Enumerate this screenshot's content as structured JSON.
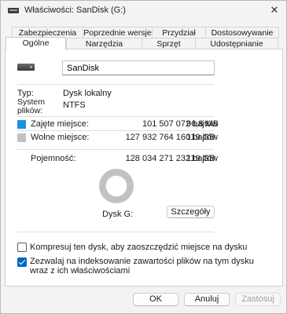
{
  "window": {
    "title": "Właściwości: SanDisk (G:)",
    "close_glyph": "✕"
  },
  "tabs_row1": [
    "Zabezpieczenia",
    "Poprzednie wersje",
    "Przydział",
    "Dostosowywanie"
  ],
  "tabs_row2": [
    "Ogólne",
    "Narzędzia",
    "Sprzęt",
    "Udostępnianie"
  ],
  "active_tab": "Ogólne",
  "drive": {
    "icon": "drive-icon",
    "name_value": "SanDisk"
  },
  "info": {
    "type_label": "Typ:",
    "type_value": "Dysk lokalny",
    "fs_label_line1": "System",
    "fs_label_line2": "plików:",
    "fs_value": "NTFS"
  },
  "usage": {
    "used_label": "Zajęte miejsce:",
    "used_bytes": "101 507 072 bajtów",
    "used_human": "96,8 MB",
    "free_label": "Wolne miejsce:",
    "free_bytes": "127 932 764 160 bajtów",
    "free_human": "119 GB",
    "capacity_label": "Pojemność:",
    "capacity_bytes": "128 034 271 232 bajtów",
    "capacity_human": "119 GB",
    "used_fraction": 0.0008,
    "used_color": "#1e90d6",
    "free_color": "#c2c2c2"
  },
  "disk_label": "Dysk G:",
  "details_button": "Szczegóły",
  "options": {
    "compress_label": "Kompresuj ten dysk, aby zaoszczędzić miejsce na dysku",
    "compress_checked": false,
    "index_label_line1": "Zezwalaj na indeksowanie zawartości plików na tym dysku",
    "index_label_line2": "wraz z ich właściwościami",
    "index_checked": true
  },
  "buttons": {
    "ok": "OK",
    "cancel": "Anuluj",
    "apply": "Zastosuj"
  }
}
